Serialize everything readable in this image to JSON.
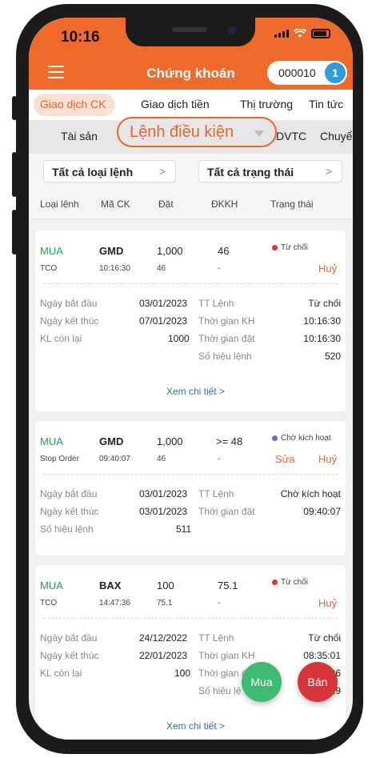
{
  "status_bar": {
    "time": "10:16"
  },
  "header": {
    "title": "Chứng khoán",
    "account": "000010",
    "badge": "1"
  },
  "tabs": [
    "Giao dịch CK",
    "Giao dịch tiền",
    "Thị trường",
    "Tin tức"
  ],
  "subtabs": {
    "left": "Tài sản",
    "active": "Lệnh điều kiện",
    "partial1": "DVTC",
    "partial2": "Chuyể"
  },
  "filters": {
    "order_type": "Tất cả loại lệnh",
    "status": "Tất cả trạng thái"
  },
  "columns": [
    "Loại lệnh",
    "Mã CK",
    "Đặt",
    "ĐKKH",
    "Trạng thái"
  ],
  "orders": [
    {
      "side": "MUA",
      "symbol": "GMD",
      "qty": "1,000",
      "condition": "46",
      "status": "Từ chối",
      "status_color": "#d6363a",
      "type": "TCO",
      "time": "10:16:30",
      "price": "46",
      "cond_sub": "-",
      "actions": {
        "cancel": "Huỷ"
      },
      "details_left": [
        {
          "label": "Ngày bắt đầu",
          "value": "03/01/2023"
        },
        {
          "label": "Ngày kết thúc",
          "value": "07/01/2023"
        },
        {
          "label": "KL còn lại",
          "value": "1000"
        }
      ],
      "details_right": [
        {
          "label": "TT Lệnh",
          "value": "Từ chối"
        },
        {
          "label": "Thời gian KH",
          "value": "10:16:30"
        },
        {
          "label": "Thời gian đặt",
          "value": "10:16:30"
        },
        {
          "label": "Số hiệu lệnh",
          "value": "520"
        }
      ],
      "link": "Xem chi tiết >"
    },
    {
      "side": "MUA",
      "symbol": "GMD",
      "qty": "1,000",
      "condition": ">= 48",
      "status": "Chờ kích hoạt",
      "status_color": "#5b6fd6",
      "type": "Stop Order",
      "time": "09:40:07",
      "price": "46",
      "cond_sub": "-",
      "actions": {
        "edit": "Sửa",
        "cancel": "Huỷ"
      },
      "details_left": [
        {
          "label": "Ngày bắt đầu",
          "value": "03/01/2023"
        },
        {
          "label": "Ngày kết thúc",
          "value": "03/01/2023"
        },
        {
          "label": "Số hiệu lệnh",
          "value": "511"
        }
      ],
      "details_right": [
        {
          "label": "TT Lệnh",
          "value": "Chờ kích hoạt"
        },
        {
          "label": "Thời gian đặt",
          "value": "09:40:07"
        }
      ]
    },
    {
      "side": "MUA",
      "symbol": "BAX",
      "qty": "100",
      "condition": "75.1",
      "status": "Từ chối",
      "status_color": "#d6363a",
      "type": "TCO",
      "time": "14:47:36",
      "price": "75.1",
      "cond_sub": "-",
      "actions": {
        "cancel": "Huỷ"
      },
      "details_left": [
        {
          "label": "Ngày bắt đầu",
          "value": "24/12/2022"
        },
        {
          "label": "Ngày kết thúc",
          "value": "22/01/2023"
        },
        {
          "label": "KL còn lại",
          "value": "100"
        }
      ],
      "details_right": [
        {
          "label": "TT Lệnh",
          "value": "Từ chối"
        },
        {
          "label": "Thời gian KH",
          "value": "08:35:01"
        },
        {
          "label": "Thời gian đặt",
          "value": "14:47:36"
        },
        {
          "label": "Số hiệu lệ",
          "value": "29"
        }
      ],
      "link": "Xem chi tiết >"
    }
  ],
  "fab": {
    "buy": "Mua",
    "sell": "Bán"
  }
}
